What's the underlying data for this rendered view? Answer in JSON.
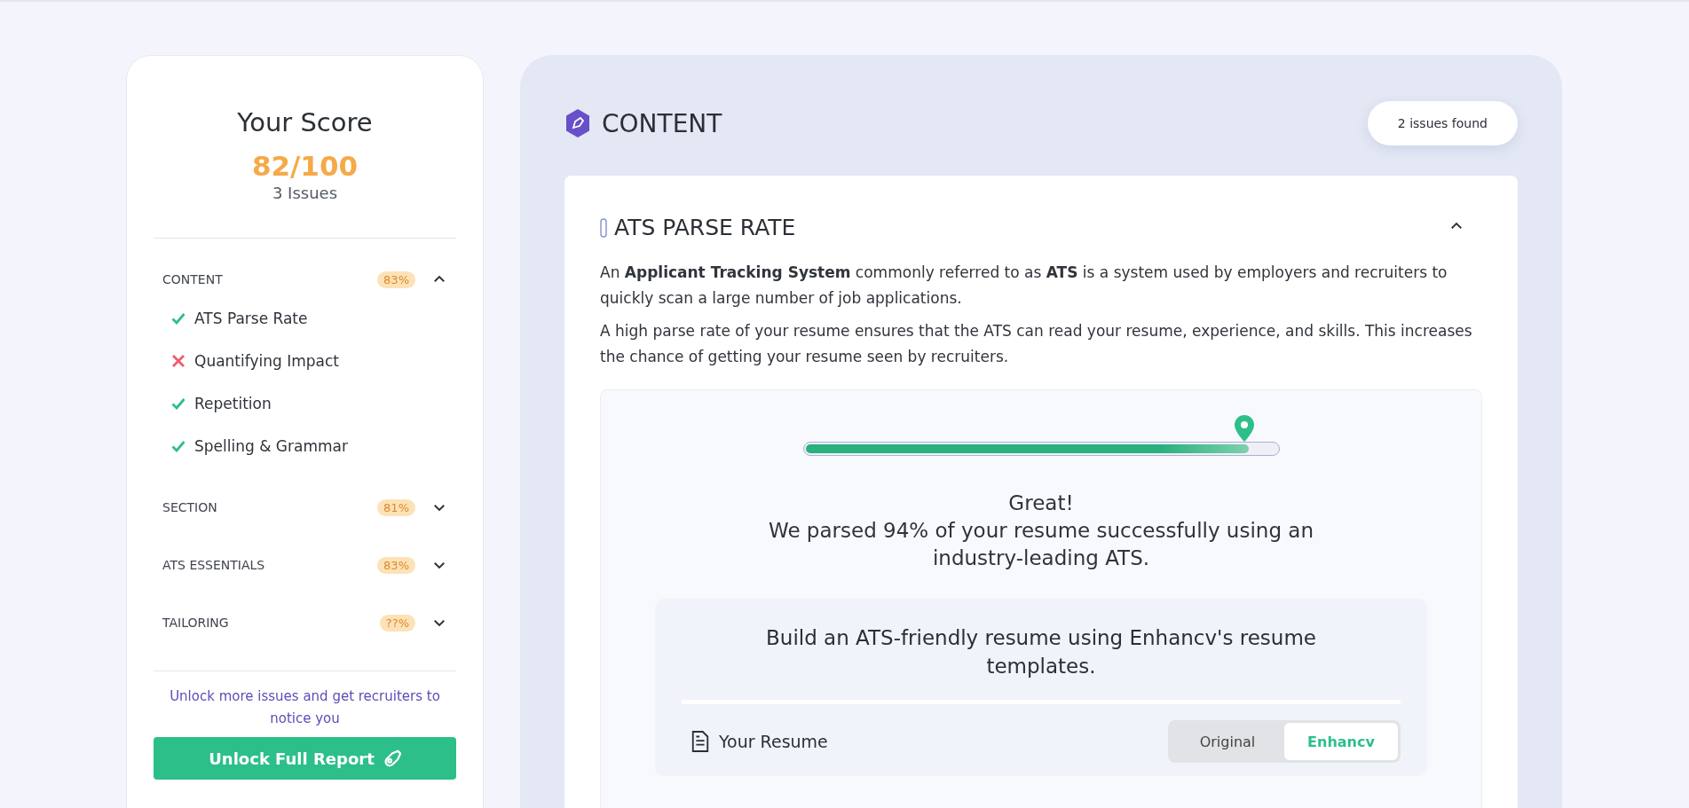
{
  "score_panel": {
    "title": "Your Score",
    "score": "82/100",
    "issues": "3 Issues",
    "categories": [
      {
        "name": "CONTENT",
        "badge": "83%",
        "expanded": true,
        "checks": [
          {
            "label": "ATS Parse Rate",
            "passed": true
          },
          {
            "label": "Quantifying Impact",
            "passed": false
          },
          {
            "label": "Repetition",
            "passed": true
          },
          {
            "label": "Spelling & Grammar",
            "passed": true
          }
        ]
      },
      {
        "name": "SECTION",
        "badge": "81%",
        "expanded": false
      },
      {
        "name": "ATS ESSENTIALS",
        "badge": "83%",
        "expanded": false
      },
      {
        "name": "TAILORING",
        "badge": "??%",
        "expanded": false
      }
    ],
    "promo": "Unlock more issues and get recruiters to notice you",
    "button": "Unlock Full Report"
  },
  "content_panel": {
    "title": "CONTENT",
    "issues_badge": "2 issues found",
    "section": {
      "title": "ATS PARSE RATE",
      "expanded": true,
      "paragraphs": [
        "An **Applicant Tracking System** commonly referred to as **ATS** is a system used by employers and recruiters to quickly scan a large number of job applications.",
        "A high parse rate of your resume ensures that the ATS can read your resume, experience, and skills. This increases the chance of getting your resume seen by recruiters."
      ],
      "parse": {
        "level": 0.94,
        "headline": "Great!",
        "message": "We parsed 94% of your resume successfully using an industry-leading ATS."
      },
      "promo": {
        "text": "Build an ATS-friendly resume using Enhancv's resume templates.",
        "row_label": "Your Resume",
        "toggle": [
          {
            "label": "Original",
            "selected": false
          },
          {
            "label": "Enhancv",
            "selected": true
          }
        ]
      }
    }
  }
}
